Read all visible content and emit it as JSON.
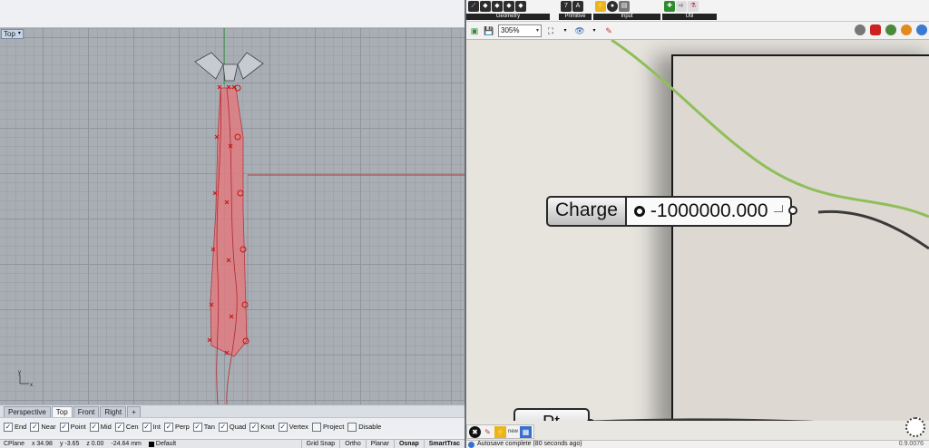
{
  "rhino": {
    "viewport": {
      "label": "Top",
      "axis_label_y": "y",
      "axis_label_x": "x"
    },
    "view_tabs": [
      {
        "label": "Perspective",
        "active": false
      },
      {
        "label": "Top",
        "active": true
      },
      {
        "label": "Front",
        "active": false
      },
      {
        "label": "Right",
        "active": false
      },
      {
        "label": "+",
        "active": false
      }
    ],
    "osnaps": [
      {
        "label": "End",
        "checked": true
      },
      {
        "label": "Near",
        "checked": true
      },
      {
        "label": "Point",
        "checked": true
      },
      {
        "label": "Mid",
        "checked": true
      },
      {
        "label": "Cen",
        "checked": true
      },
      {
        "label": "Int",
        "checked": true
      },
      {
        "label": "Perp",
        "checked": true
      },
      {
        "label": "Tan",
        "checked": true
      },
      {
        "label": "Quad",
        "checked": true
      },
      {
        "label": "Knot",
        "checked": true
      },
      {
        "label": "Vertex",
        "checked": true
      },
      {
        "label": "Project",
        "checked": false
      },
      {
        "label": "Disable",
        "checked": false
      }
    ],
    "status": {
      "cplane": "CPlane",
      "x": "x 34.98",
      "y": "y -3.65",
      "z": "z 0.00",
      "distance": "-24.64 mm",
      "layer": "Default",
      "buttons": [
        {
          "label": "Grid Snap",
          "bold": false
        },
        {
          "label": "Ortho",
          "bold": false
        },
        {
          "label": "Planar",
          "bold": false
        },
        {
          "label": "Osnap",
          "bold": true
        },
        {
          "label": "SmartTrac",
          "bold": true
        }
      ]
    },
    "colors": {
      "tie_fill": "#e07c80",
      "tie_stroke": "#b5262c",
      "cursor_line": "#b53a3a",
      "axis_green": "#2f9a3b"
    }
  },
  "grasshopper": {
    "ribbon_groups": [
      {
        "label": "Geometry",
        "icons": [
          "curve-icon",
          "surface-icon",
          "mesh-icon",
          "brep-icon",
          "point-icon"
        ]
      },
      {
        "label": "Primitive",
        "icons": [
          "boolean-icon",
          "number-icon"
        ]
      },
      {
        "label": "Input",
        "icons": [
          "slider-icon",
          "toggle-icon",
          "panel-icon"
        ]
      },
      {
        "label": "Util",
        "icons": [
          "cluster-icon",
          "arrow-icon",
          "flask-icon"
        ]
      }
    ],
    "toolbar": {
      "zoom": "305%"
    },
    "nodes": {
      "charge": {
        "label": "Charge",
        "value": "-1000000.000"
      },
      "pt": {
        "label": "Pt"
      }
    },
    "status": {
      "message": "Autosave complete (80 seconds ago)",
      "version": "0.9.0076"
    },
    "colors": {
      "wire_green": "#8fbe5a",
      "wire_dark": "#3a3a3a",
      "canvas": "#e7e4de"
    }
  }
}
